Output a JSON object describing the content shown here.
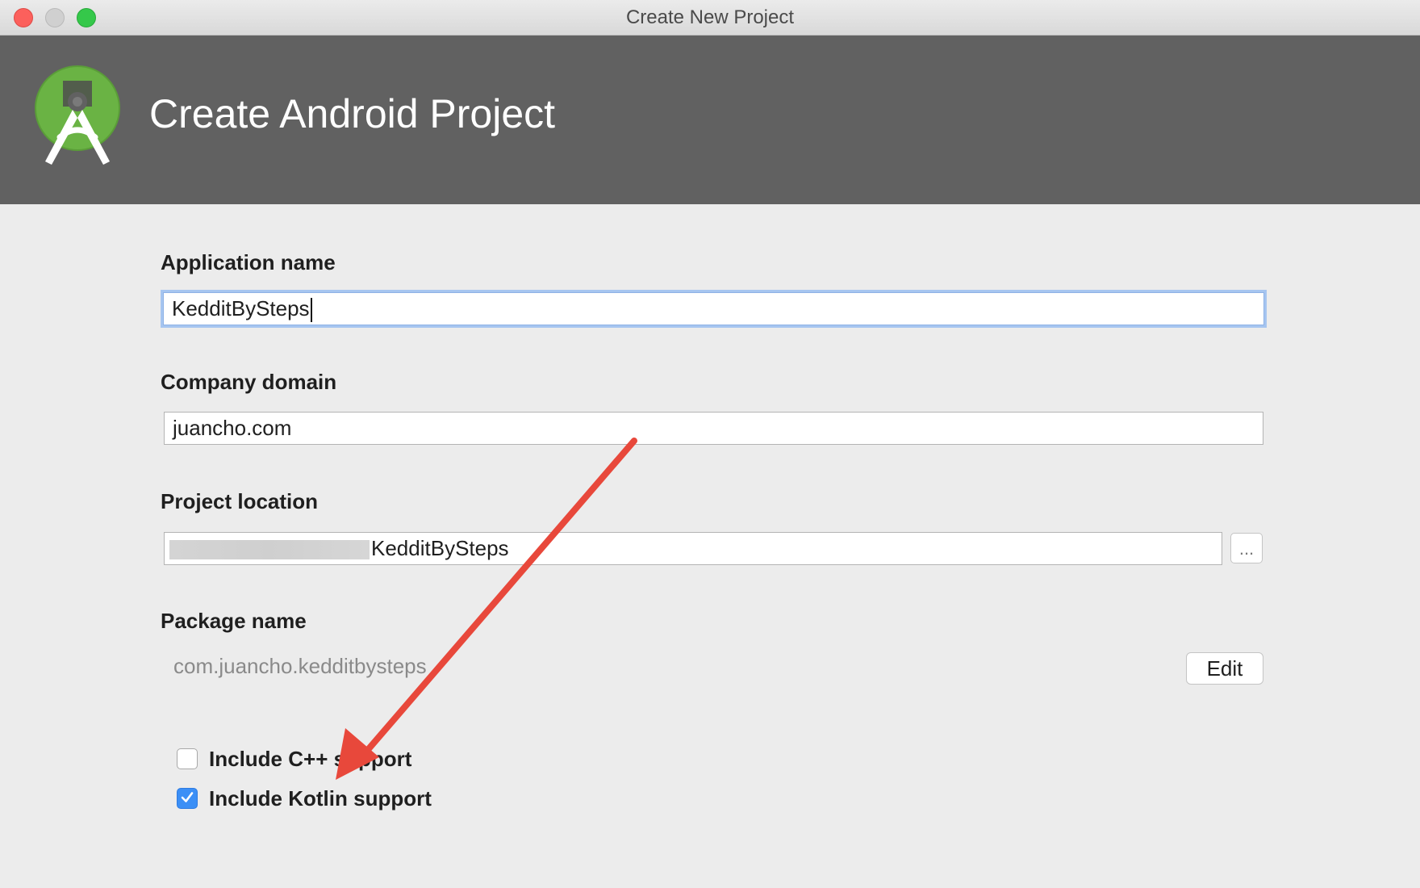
{
  "window": {
    "title": "Create New Project"
  },
  "header": {
    "title": "Create Android Project",
    "logo_icon": "android-studio-logo-icon"
  },
  "form": {
    "application_name": {
      "label": "Application name",
      "value": "KedditBySteps"
    },
    "company_domain": {
      "label": "Company domain",
      "value": "juancho.com"
    },
    "project_location": {
      "label": "Project location",
      "value": "KedditBySteps",
      "browse_label": "..."
    },
    "package_name": {
      "label": "Package name",
      "value": "com.juancho.kedditbysteps",
      "edit_label": "Edit"
    },
    "options": [
      {
        "label": "Include C++ support",
        "checked": false
      },
      {
        "label": "Include Kotlin support",
        "checked": true
      }
    ]
  },
  "annotation": {
    "arrow_color": "#e8483b"
  },
  "colors": {
    "header_bg": "#616161",
    "window_bg": "#ececec",
    "checkbox_accent": "#3b8ff6",
    "focus_ring": "#a6c5f0"
  }
}
